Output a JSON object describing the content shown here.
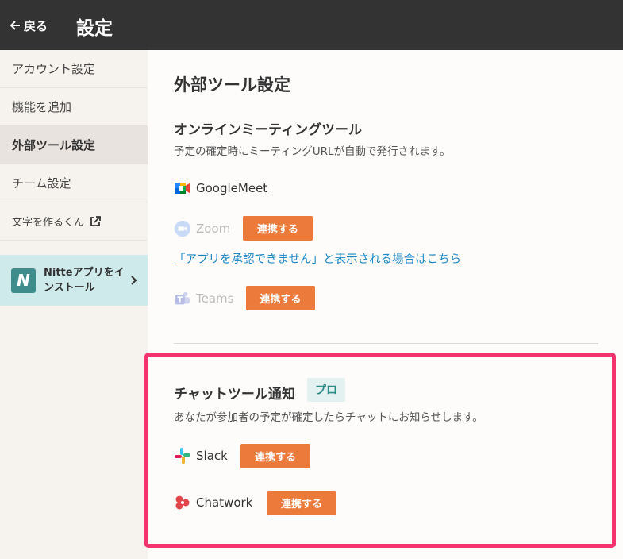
{
  "header": {
    "back_label": "戻る",
    "title": "設定"
  },
  "sidebar": {
    "items": [
      {
        "label": "アカウント設定"
      },
      {
        "label": "機能を追加"
      },
      {
        "label": "外部ツール設定"
      },
      {
        "label": "チーム設定"
      },
      {
        "label": "文字を作るくん"
      }
    ],
    "promo": {
      "logo_letter": "N",
      "label": "Nitteアプリをインストール"
    }
  },
  "main": {
    "title": "外部ツール設定",
    "meeting": {
      "heading": "オンラインミーティングツール",
      "description": "予定の確定時にミーティングURLが自動で発行されます。",
      "google_meet": "GoogleMeet",
      "zoom": "Zoom",
      "zoom_button": "連携する",
      "zoom_help_link": "「アプリを承認できません」と表示される場合はこちら",
      "teams": "Teams",
      "teams_button": "連携する"
    },
    "chat": {
      "heading": "チャットツール通知",
      "badge": "プロ",
      "description": "あなたが参加者の予定が確定したらチャットにお知らせします。",
      "slack": "Slack",
      "slack_button": "連携する",
      "chatwork": "Chatwork",
      "chatwork_button": "連携する"
    }
  },
  "colors": {
    "header_bg": "#333333",
    "accent_button": "#ec7a3b",
    "link": "#1e88c7",
    "highlight_border": "#f4336e",
    "badge_text": "#2e8a8a"
  }
}
